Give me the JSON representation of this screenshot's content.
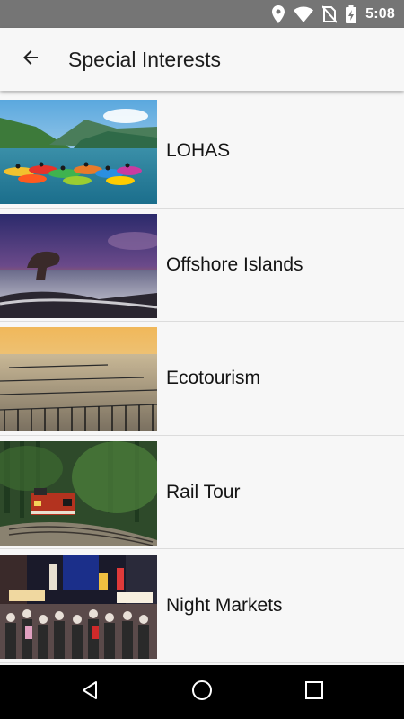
{
  "status_bar": {
    "time": "5:08",
    "icons": [
      "location-icon",
      "wifi-icon",
      "no-sim-icon",
      "battery-charging-icon"
    ]
  },
  "header": {
    "title": "Special Interests",
    "back_icon": "arrow-back-icon"
  },
  "items": [
    {
      "label": "LOHAS",
      "thumbnail": "kayaks-on-lake-photo"
    },
    {
      "label": "Offshore Islands",
      "thumbnail": "rock-formation-sunset-photo"
    },
    {
      "label": "Ecotourism",
      "thumbnail": "oyster-racks-sunset-photo"
    },
    {
      "label": "Rail Tour",
      "thumbnail": "forest-train-photo"
    },
    {
      "label": "Night Markets",
      "thumbnail": "night-market-crowd-photo"
    }
  ],
  "nav_bar": {
    "back": "nav-back-icon",
    "home": "nav-home-icon",
    "recents": "nav-recents-icon"
  },
  "colors": {
    "status_bar": "#757575",
    "app_bar": "#f7f7f7",
    "nav_bar": "#000000",
    "divider": "#dcdcdc"
  }
}
